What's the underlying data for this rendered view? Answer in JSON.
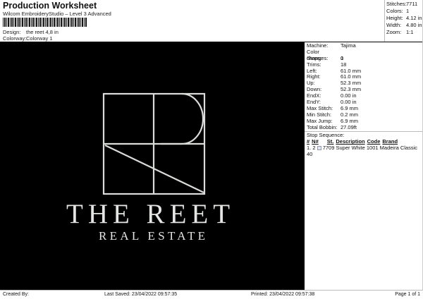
{
  "header": {
    "title": "Production Worksheet",
    "subtitle": "Wilcom EmbroideryStudio – Level 3 Advanced",
    "design_label": "Design:",
    "design_value": "the reet 4,8 in",
    "colorway_label": "Colorway:",
    "colorway_value": "Colorway 1"
  },
  "stats": [
    {
      "label": "Stitches:",
      "value": "7711"
    },
    {
      "label": "Colors:",
      "value": "1"
    },
    {
      "label": "Height:",
      "value": "4.12 in"
    },
    {
      "label": "Width:",
      "value": "4.80 in"
    },
    {
      "label": "Zoom:",
      "value": "1:1"
    }
  ],
  "design": {
    "line1": "THE REET",
    "line2": "REAL ESTATE"
  },
  "details": [
    {
      "label": "Machine:",
      "value": "Tajima"
    },
    {
      "label": "Color changes:",
      "value": "0"
    },
    {
      "label": "Stops:",
      "value": "1"
    },
    {
      "label": "Trims:",
      "value": "18"
    },
    {
      "label": "Left:",
      "value": "61.0 mm"
    },
    {
      "label": "Right:",
      "value": "61.0 mm"
    },
    {
      "label": "Up:",
      "value": "52.3 mm"
    },
    {
      "label": "Down:",
      "value": "52.3 mm"
    },
    {
      "label": "EndX:",
      "value": "0.00 in"
    },
    {
      "label": "EndY:",
      "value": "0.00 in"
    },
    {
      "label": "Max Stitch:",
      "value": "6.9 mm"
    },
    {
      "label": "Min Stitch:",
      "value": "0.2 mm"
    },
    {
      "label": "Max Jump:",
      "value": "6.9 mm"
    },
    {
      "label": "Total Bobbin:",
      "value": "27.09ft"
    }
  ],
  "stop_sequence": {
    "title": "Stop Sequence:",
    "headers": [
      "#",
      "N#",
      "St.",
      "Description",
      "Code",
      "Brand"
    ],
    "rows": [
      {
        "num": "1.",
        "n": "2",
        "st": "7709",
        "description": "Super White",
        "code": "1001",
        "brand": "Madeira Classic 40"
      }
    ]
  },
  "footer": {
    "created_by": "Created By:",
    "last_saved": "Last Saved: 23/04/2022 09:57:35",
    "printed": "Printed: 23/04/2022 09:57:38",
    "page": "Page 1 of 1"
  }
}
